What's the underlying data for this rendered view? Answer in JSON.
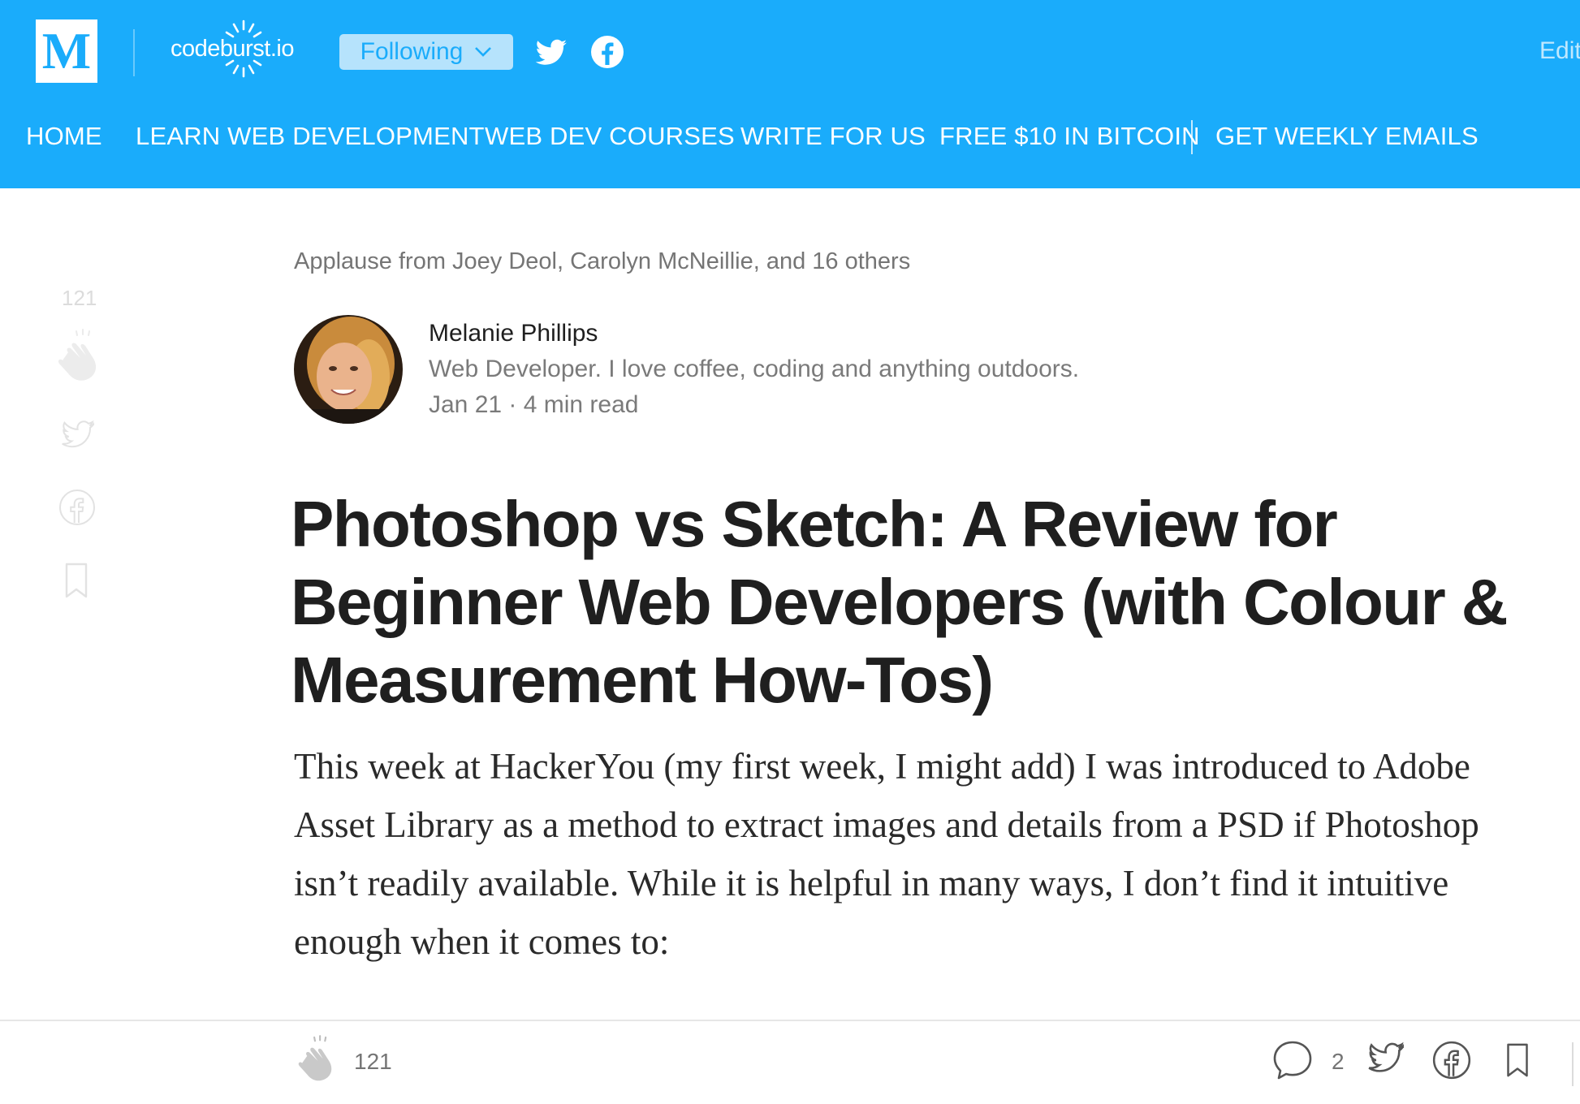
{
  "header": {
    "logo_letter": "M",
    "publication": "codeburst.io",
    "follow_label": "Following",
    "edit_label": "Edit",
    "twitter_icon": "twitter-icon",
    "facebook_icon": "facebook-icon",
    "nav": [
      {
        "label": "HOME"
      },
      {
        "label": "LEARN WEB DEVELOPMENT"
      },
      {
        "label": "WEB DEV COURSES"
      },
      {
        "label": "WRITE FOR US"
      },
      {
        "label": "FREE $10 IN BITCOIN"
      },
      {
        "label": "GET WEEKLY EMAILS"
      }
    ]
  },
  "rail": {
    "clap_count": "121",
    "icons": [
      "clap-icon",
      "twitter-icon",
      "facebook-icon",
      "bookmark-icon"
    ]
  },
  "article": {
    "applause": "Applause from Joey Deol, Carolyn McNeillie, and 16 others",
    "author": {
      "name": "Melanie Phillips",
      "bio": "Web Developer. I love coffee, coding and anything outdoors.",
      "meta": "Jan 21 · 4 min read"
    },
    "title": "Photoshop vs Sketch: A Review for Beginner Web Developers (with Colour & Measurement How-Tos)",
    "body": "This week at HackerYou (my first week, I might add) I was introduced to Adobe Asset Library as a method to extract images and details from a PSD if Photoshop isn’t readily available. While it is helpful in many ways, I don’t find it intuitive enough when it comes to:"
  },
  "bottom_bar": {
    "clap_count": "121",
    "responses_count": "2",
    "icons": [
      "clap-icon",
      "response-icon",
      "twitter-icon",
      "facebook-icon",
      "bookmark-icon"
    ]
  },
  "colors": {
    "brand": "#1aacfb",
    "follow_bg": "#b6e3fc",
    "text_dark": "#1f1f1f",
    "text_muted": "#757575"
  }
}
